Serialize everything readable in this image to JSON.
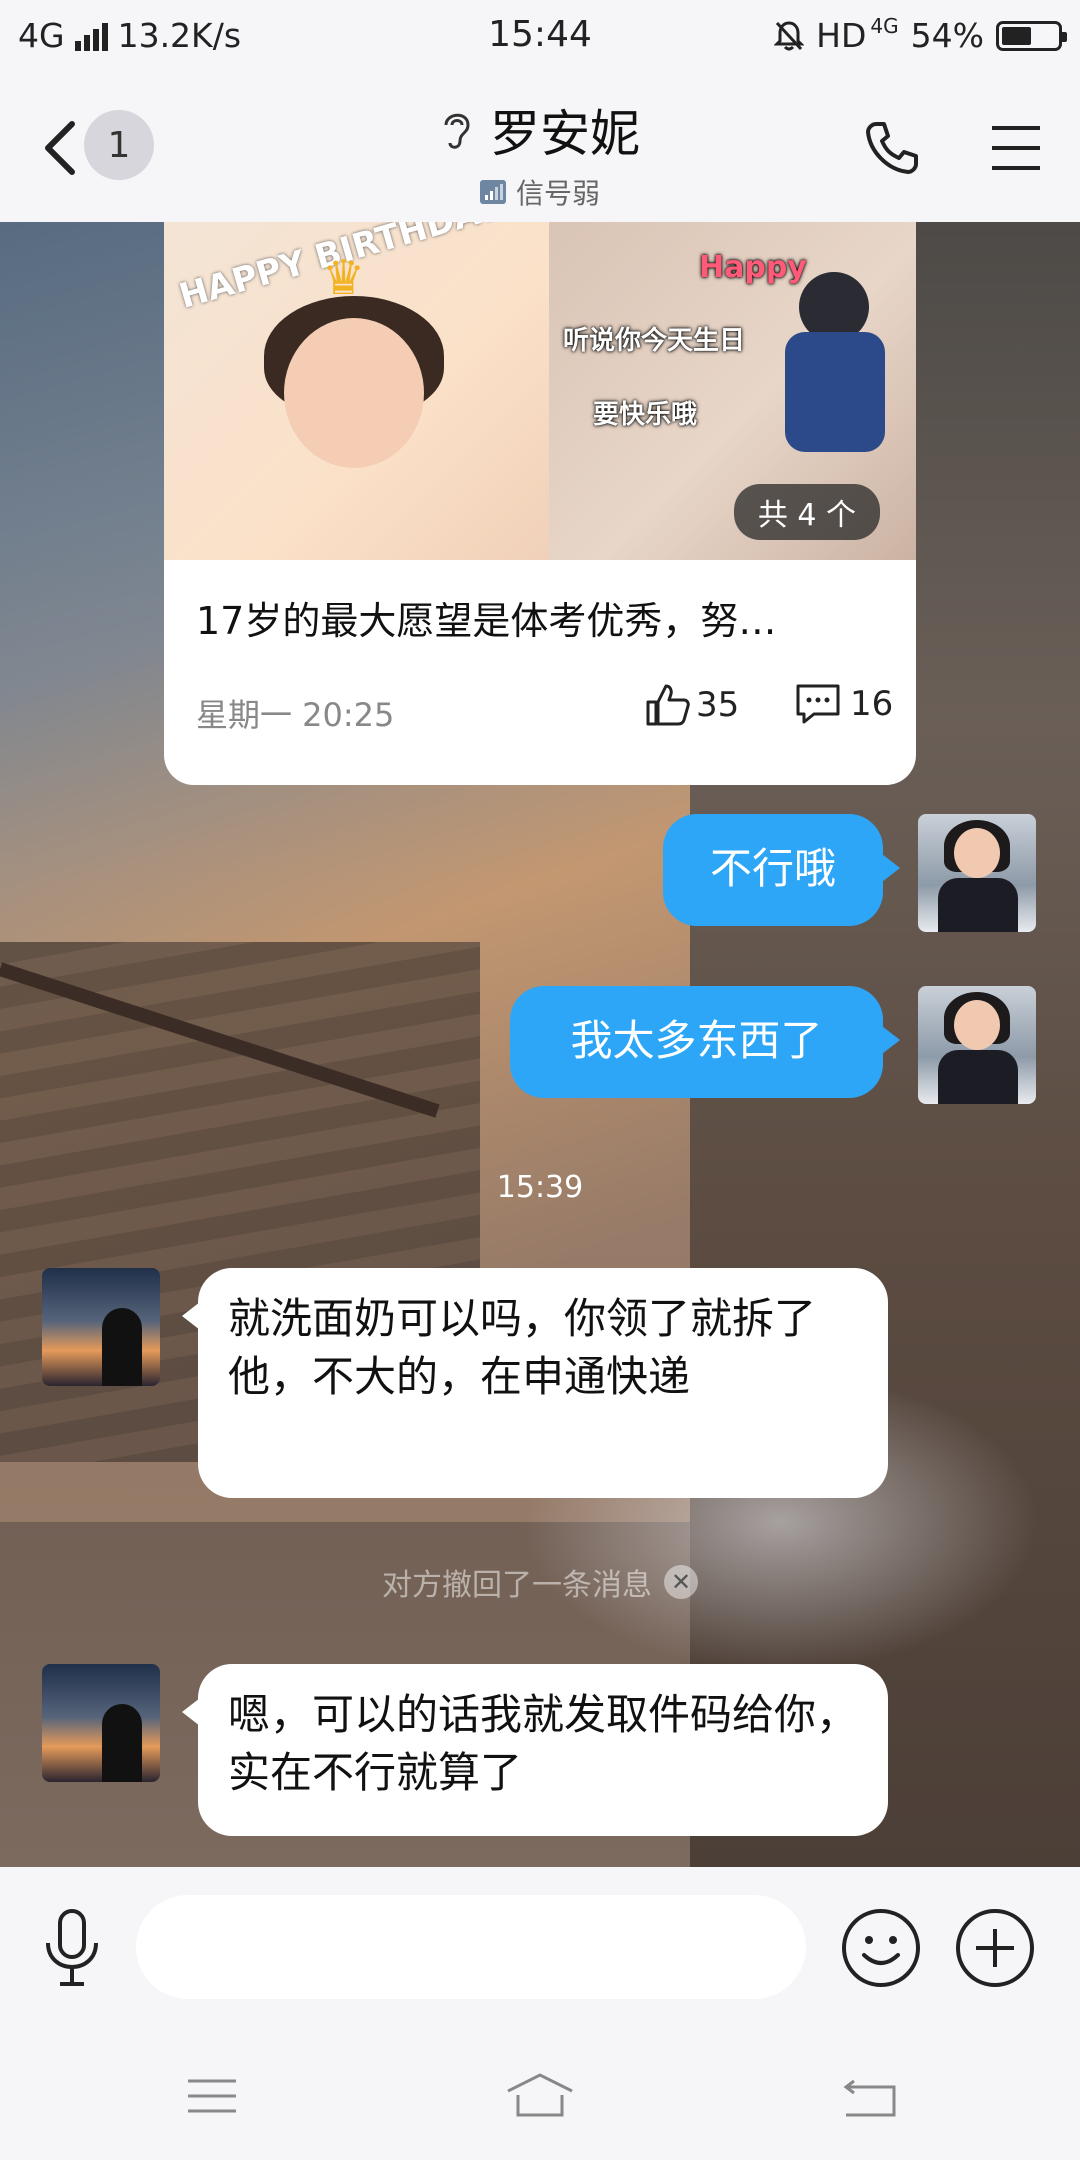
{
  "status_bar": {
    "network": "4G",
    "speed": "13.2K/s",
    "time": "15:44",
    "hd": "HD",
    "hd_network": "4G",
    "battery": "54%",
    "battery_level": 0.54
  },
  "header": {
    "back_count": "1",
    "title": "罗安妮",
    "subtitle": "信号弱"
  },
  "shared_post": {
    "image_a_text": "HAPPY BIRTHDAY",
    "image_b_line1": "听说你今天生日",
    "image_b_line2": "要快乐哦",
    "image_b_happy": "Happy",
    "count_label": "共 4 个",
    "title": "17岁的最大愿望是体考优秀，努…",
    "time": "星期一 20:25",
    "likes": "35",
    "comments": "16"
  },
  "messages": [
    {
      "side": "out",
      "text": "不行哦"
    },
    {
      "side": "out",
      "text": "我太多东西了"
    },
    {
      "side": "in",
      "text": "就洗面奶可以吗，你领了就拆了他，不大的，在申通快递"
    },
    {
      "side": "in",
      "text": "嗯，可以的话我就发取件码给你，实在不行就算了"
    }
  ],
  "timestamp": "15:39",
  "recall_notice": "对方撤回了一条消息",
  "input": {
    "placeholder": ""
  },
  "colors": {
    "outgoing_bubble": "#2ea6f8",
    "incoming_bubble": "#ffffff",
    "bar_bg": "#f6f6f8"
  },
  "icons": [
    "signal-icon",
    "battery-icon",
    "mute-bell-icon",
    "back-arrow-icon",
    "ear-icon",
    "signal-weak-icon",
    "phone-icon",
    "menu-icon",
    "thumbs-up-icon",
    "comment-icon",
    "mic-icon",
    "emoji-icon",
    "plus-icon",
    "nav-menu-icon",
    "nav-home-icon",
    "nav-back-icon"
  ]
}
